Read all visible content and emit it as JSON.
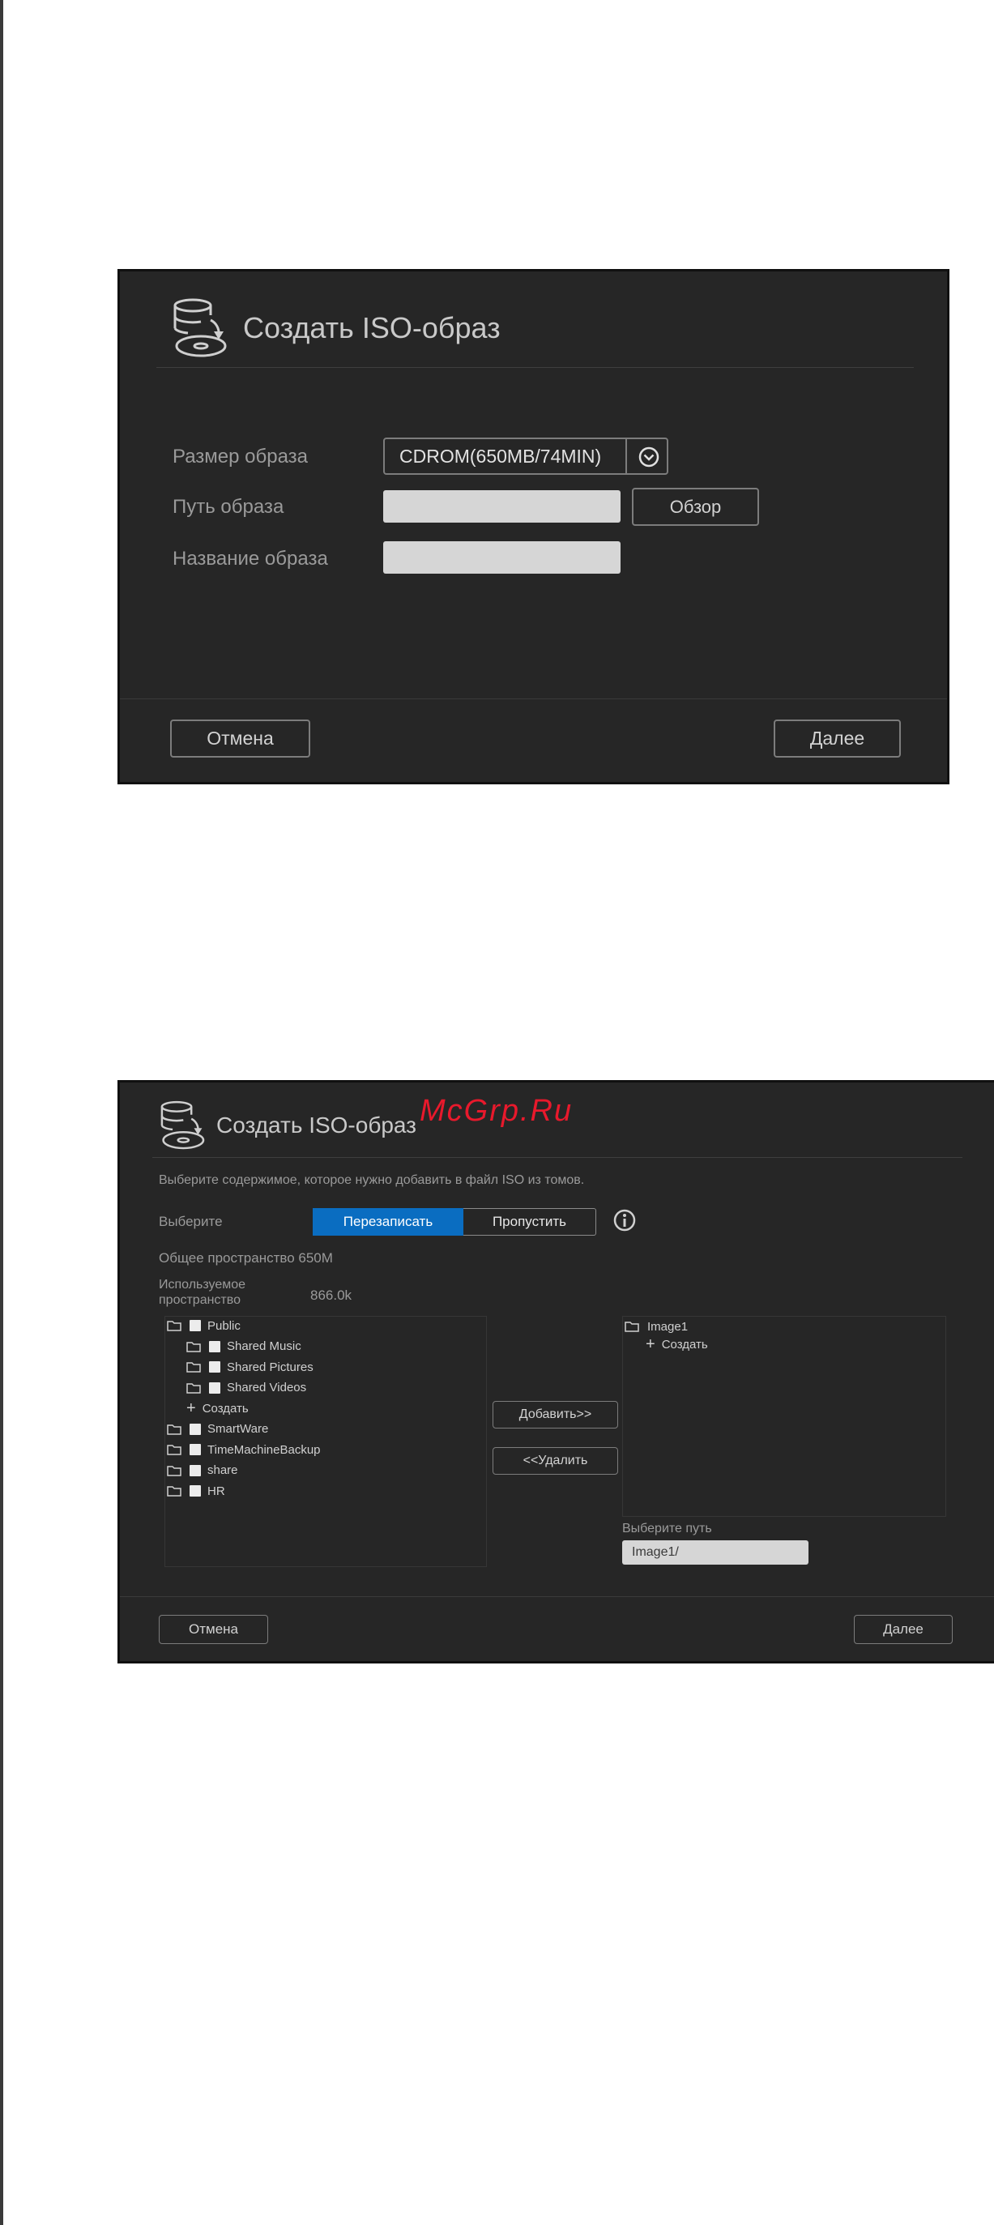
{
  "dialog1": {
    "title": "Создать ISO-образ",
    "size_label": "Размер образа",
    "size_value": "CDROM(650MB/74MIN)",
    "path_label": "Путь образа",
    "path_value": "",
    "browse_label": "Обзор",
    "name_label": "Название образа",
    "name_value": "",
    "cancel_label": "Отмена",
    "next_label": "Далее"
  },
  "dialog2": {
    "title": "Создать ISO-образ",
    "watermark": "McGrp.Ru",
    "instruction": "Выберите содержимое, которое нужно добавить в файл ISO из томов.",
    "choose_label": "Выберите",
    "overwrite_label": "Перезаписать",
    "skip_label": "Пропустить",
    "total_space": "Общее пространство 650M",
    "used_space_label": "Используемое пространство",
    "used_space_value": "866.0k",
    "source_tree": [
      {
        "label": "Public",
        "level": 0,
        "type": "folder"
      },
      {
        "label": "Shared Music",
        "level": 1,
        "type": "folder"
      },
      {
        "label": "Shared Pictures",
        "level": 1,
        "type": "folder"
      },
      {
        "label": "Shared Videos",
        "level": 1,
        "type": "folder"
      },
      {
        "label": "Создать",
        "level": 1,
        "type": "create"
      },
      {
        "label": "SmartWare",
        "level": 0,
        "type": "folder"
      },
      {
        "label": "TimeMachineBackup",
        "level": 0,
        "type": "folder"
      },
      {
        "label": "share",
        "level": 0,
        "type": "folder"
      },
      {
        "label": "HR",
        "level": 0,
        "type": "folder"
      }
    ],
    "add_label": "Добавить>>",
    "remove_label": "<<Удалить",
    "dest_root": "Image1",
    "dest_create": "Создать",
    "choose_path_label": "Выберите путь",
    "path_value": "Image1/",
    "cancel_label": "Отмена",
    "next_label": "Далее"
  }
}
